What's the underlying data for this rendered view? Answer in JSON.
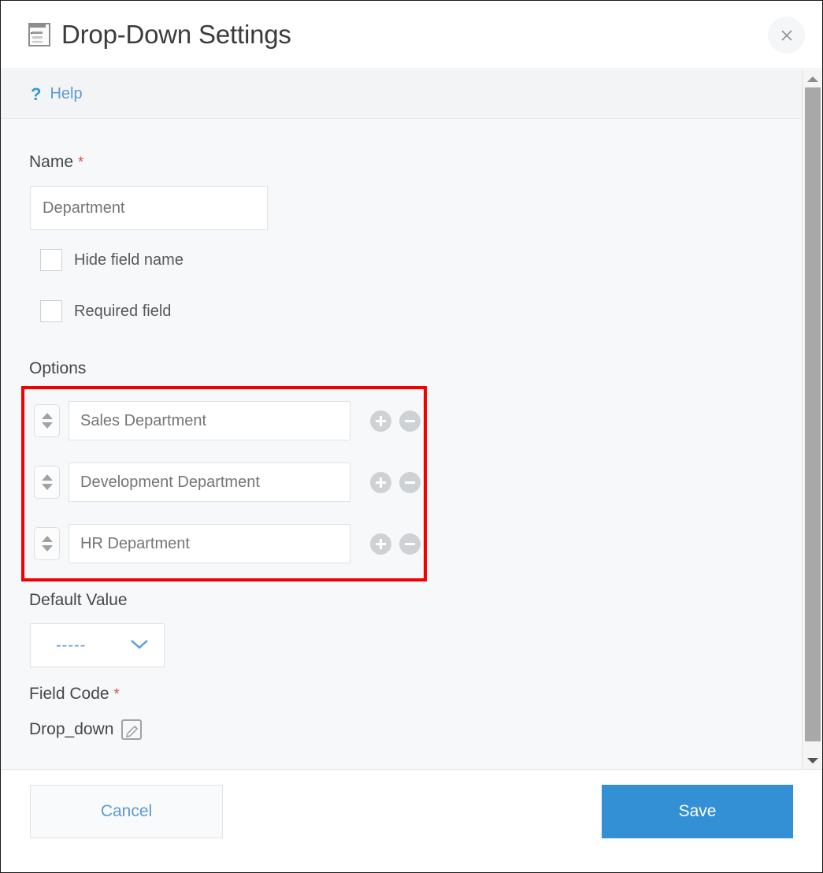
{
  "window": {
    "title": "Drop-Down Settings",
    "title_icon": "dropdown-field-icon",
    "close_icon": "close-icon"
  },
  "help": {
    "icon": "question-mark-icon",
    "label": "Help"
  },
  "form": {
    "name": {
      "label": "Name",
      "required_marker": "*",
      "value": "",
      "placeholder": "Department"
    },
    "checkboxes": [
      {
        "label": "Hide field name",
        "checked": false
      },
      {
        "label": "Required field",
        "checked": false
      }
    ],
    "options": {
      "label": "Options",
      "rows": [
        {
          "placeholder": "Sales Department",
          "drag_icon": "drag-updown-icon",
          "add_icon": "plus-circle-icon",
          "remove_icon": "minus-circle-icon"
        },
        {
          "placeholder": "Development Department",
          "drag_icon": "drag-updown-icon",
          "add_icon": "plus-circle-icon",
          "remove_icon": "minus-circle-icon"
        },
        {
          "placeholder": "HR Department",
          "drag_icon": "drag-updown-icon",
          "add_icon": "plus-circle-icon",
          "remove_icon": "minus-circle-icon"
        }
      ]
    },
    "default_value": {
      "label": "Default Value",
      "selected": "-----",
      "chevron_icon": "chevron-down-icon"
    },
    "field_code": {
      "label": "Field Code",
      "required_marker": "*",
      "value": "Drop_down",
      "edit_icon": "edit-pencil-icon"
    }
  },
  "footer": {
    "cancel_label": "Cancel",
    "save_label": "Save"
  },
  "scrollbar": {
    "up_icon": "scroll-up-arrow-icon",
    "down_icon": "scroll-down-arrow-icon"
  },
  "colors": {
    "accent_blue": "#3390d5",
    "link_blue": "#5b9bd5",
    "required_red": "#d9534f",
    "highlight_red": "#f40000",
    "body_bg": "#f6f8fa"
  }
}
